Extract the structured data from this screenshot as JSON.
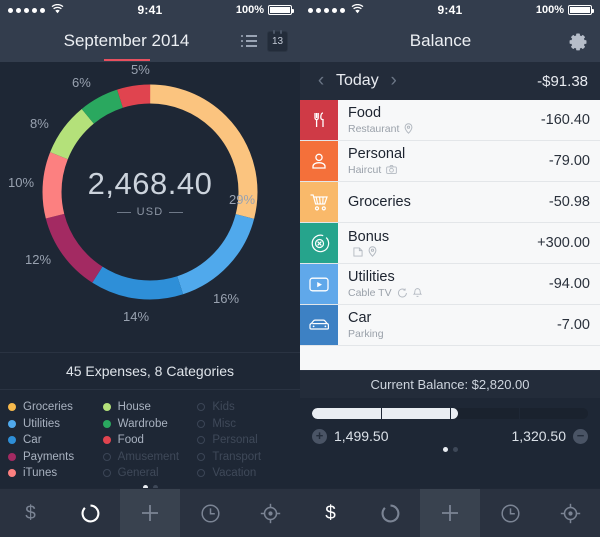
{
  "status_bar": {
    "carrier_dots": 5,
    "wifi_icon": "wifi-icon",
    "time": "9:41",
    "battery_percent": "100%"
  },
  "left_pane": {
    "nav": {
      "title": "September 2014",
      "list_icon": "list-icon",
      "calendar_badge": "13",
      "calendar_icon": "calendar-icon"
    },
    "chart_data": {
      "type": "pie",
      "title": "2,468.40",
      "subtitle": "USD",
      "currency": "USD",
      "total": "2,468.40",
      "categories": [
        "Groceries",
        "Car",
        "Payments",
        "iTunes",
        "House",
        "Wardrobe",
        "Food",
        "Utilities"
      ],
      "values": [
        29,
        16,
        14,
        12,
        10,
        8,
        6,
        5
      ],
      "labels": [
        "29%",
        "16%",
        "14%",
        "12%",
        "10%",
        "8%",
        "6%",
        "5%"
      ],
      "colors": [
        "#fbc47f",
        "#50a9ec",
        "#2e8fd8",
        "#a32a62",
        "#fc8080",
        "#b4e17a",
        "#2aa85f",
        "#e0444f"
      ],
      "legend_position": "bottom",
      "grid": false
    },
    "summary": "45 Expenses, 8 Categories",
    "legend": {
      "columns": [
        [
          {
            "label": "Groceries",
            "color": "#f6b94c",
            "active": true
          },
          {
            "label": "Utilities",
            "color": "#50a9ec",
            "active": true
          },
          {
            "label": "Car",
            "color": "#2e8fd8",
            "active": true
          },
          {
            "label": "Payments",
            "color": "#a32a62",
            "active": true
          },
          {
            "label": "iTunes",
            "color": "#fc8080",
            "active": true
          }
        ],
        [
          {
            "label": "House",
            "color": "#b4e17a",
            "active": true
          },
          {
            "label": "Wardrobe",
            "color": "#2aa85f",
            "active": true
          },
          {
            "label": "Food",
            "color": "#e0444f",
            "active": true
          },
          {
            "label": "Amusement",
            "color": "",
            "active": false
          },
          {
            "label": "General",
            "color": "",
            "active": false
          }
        ],
        [
          {
            "label": "Kids",
            "color": "",
            "active": false
          },
          {
            "label": "Misc",
            "color": "",
            "active": false
          },
          {
            "label": "Personal",
            "color": "",
            "active": false
          },
          {
            "label": "Transport",
            "color": "",
            "active": false
          },
          {
            "label": "Vacation",
            "color": "",
            "active": false
          }
        ]
      ]
    },
    "page_dots": {
      "count": 2,
      "active_index": 0
    },
    "tabbar": {
      "items": [
        {
          "icon": "dollar-icon",
          "name": "accounts"
        },
        {
          "icon": "donut-chart-icon",
          "name": "reports"
        },
        {
          "icon": "plus-icon",
          "name": "add-transaction"
        },
        {
          "icon": "clock-icon",
          "name": "history"
        },
        {
          "icon": "target-icon",
          "name": "budget"
        }
      ],
      "active_index": 2,
      "active_icon_index": 1
    }
  },
  "right_pane": {
    "nav": {
      "title": "Balance",
      "gear_icon": "gear-icon"
    },
    "subbar": {
      "prev_icon": "chevron-left-icon",
      "title": "Today",
      "next_icon": "chevron-right-icon",
      "amount": "-$91.38"
    },
    "transactions": [
      {
        "title": "Food",
        "subtitle": "Restaurant",
        "sub_icons": [
          "location-pin-icon"
        ],
        "amount": "-160.40",
        "color": "#cf3a46",
        "icon": "cutlery-icon"
      },
      {
        "title": "Personal",
        "subtitle": "Haircut",
        "sub_icons": [
          "camera-icon"
        ],
        "amount": "-79.00",
        "color": "#f4703a",
        "icon": "person-icon"
      },
      {
        "title": "Groceries",
        "subtitle": "",
        "sub_icons": [],
        "amount": "-50.98",
        "color": "#f9b96a",
        "icon": "shopping-cart-icon"
      },
      {
        "title": "Bonus",
        "subtitle": "",
        "sub_icons": [
          "note-icon",
          "location-pin-icon"
        ],
        "amount": "+300.00",
        "color": "#26a48c",
        "icon": "gift-icon"
      },
      {
        "title": "Utilities",
        "subtitle": "Cable TV",
        "sub_icons": [
          "repeat-icon",
          "bell-icon"
        ],
        "amount": "-94.00",
        "color": "#60a8ea",
        "icon": "tv-icon"
      },
      {
        "title": "Car",
        "subtitle": "Parking",
        "sub_icons": [],
        "amount": "-7.00",
        "color": "#3d81c4",
        "icon": "car-icon"
      }
    ],
    "current_balance": "Current Balance: $2,820.00",
    "budget": {
      "fill_percent": 53,
      "segments": 4,
      "left_value": "1,499.50",
      "right_value": "1,320.50",
      "left_icon": "plus-circle-icon",
      "right_icon": "minus-circle-icon"
    },
    "page_dots": {
      "count": 2,
      "active_index": 0
    },
    "tabbar": {
      "items": [
        {
          "icon": "dollar-icon",
          "name": "accounts"
        },
        {
          "icon": "donut-chart-icon",
          "name": "reports"
        },
        {
          "icon": "plus-icon",
          "name": "add-transaction"
        },
        {
          "icon": "clock-icon",
          "name": "history"
        },
        {
          "icon": "target-icon",
          "name": "budget"
        }
      ],
      "active_index": 2,
      "active_icon_index": 0
    }
  }
}
